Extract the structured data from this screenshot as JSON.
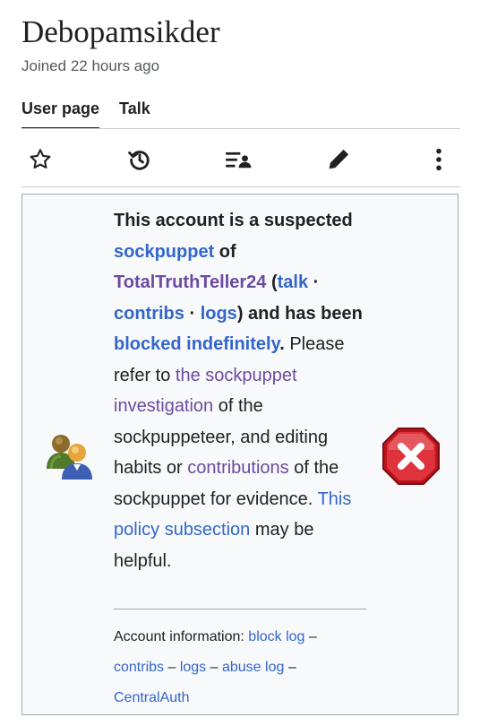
{
  "page": {
    "title": "Debopamsikder",
    "joined": "Joined 22 hours ago"
  },
  "tabs": [
    {
      "label": "User page",
      "active": true
    },
    {
      "label": "Talk",
      "active": false
    }
  ],
  "toolbar": {
    "icons": [
      "star-icon",
      "history-icon",
      "user-contributions-icon",
      "edit-pencil-icon",
      "more-menu-icon"
    ]
  },
  "notice": {
    "intro": "This account is a suspected ",
    "sockpuppet_link": "sockpuppet",
    "of": " of ",
    "master_link": "TotalTruthTeller24",
    "paren_open": " (",
    "talk_link": "talk",
    "sep1": " · ",
    "contribs_link": "contribs",
    "sep2": " · ",
    "logs_link": "logs",
    "and_has": ") and has been ",
    "blocked_link": "blocked indefinitely",
    "period": ".",
    "refer": " Please refer to ",
    "investigation_link": "the sockpuppet investigation",
    "of_the": " of the sockpuppeteer, and editing habits or ",
    "contributions_link": "contributions",
    "evidence": " of the sockpuppet for evidence. ",
    "policy_link": "This policy subsection",
    "helpful": " may be helpful."
  },
  "account_info": {
    "label": "Account information: ",
    "block_log": "block log",
    "dash1": " – ",
    "contribs": "contribs",
    "dash2": " – ",
    "logs": "logs",
    "dash3": " – ",
    "abuse_log": "abuse log",
    "dash4": " – ",
    "centralauth": "CentralAuth"
  },
  "colors": {
    "link": "#3366cc",
    "visited_link": "#6b4ba1",
    "box_bg": "#f8f9fa",
    "box_border": "#a2a9b1",
    "block_red": "#d3202a"
  }
}
